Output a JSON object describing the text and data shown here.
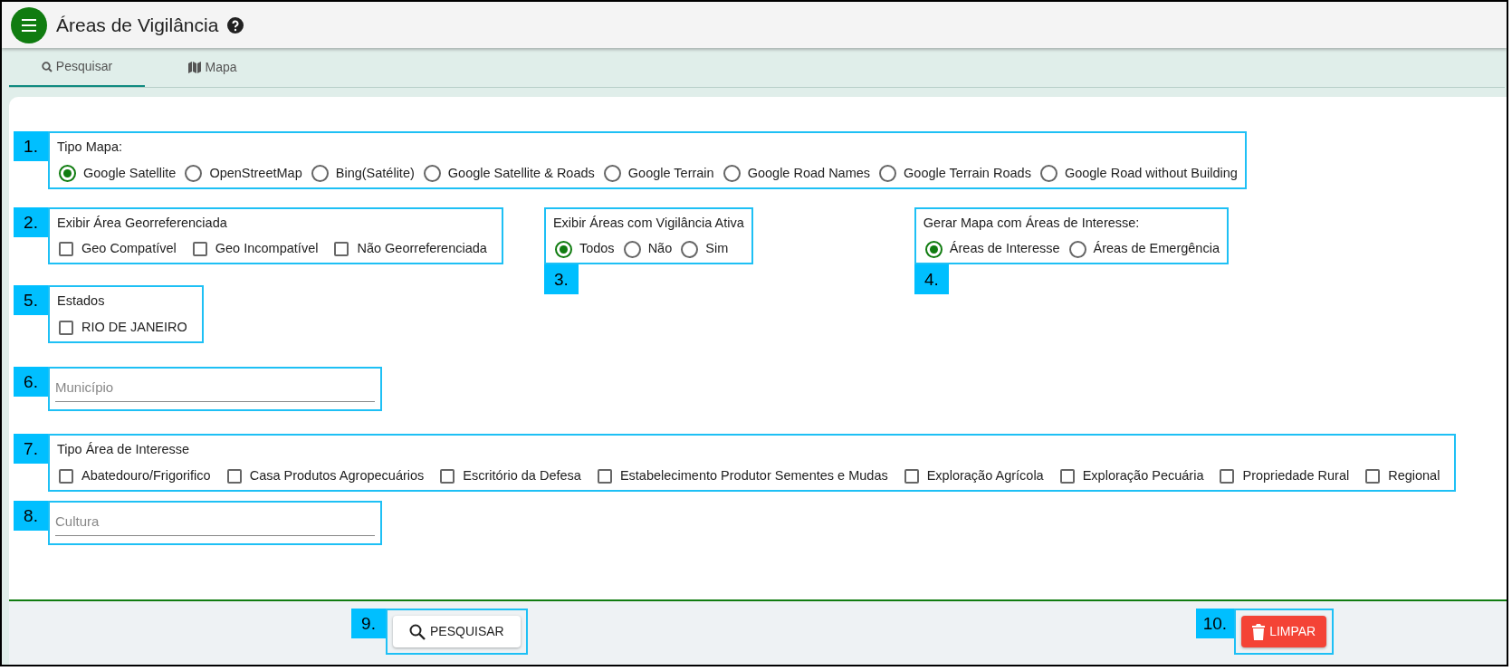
{
  "header": {
    "title": "Áreas de Vigilância"
  },
  "tabs": [
    {
      "label": "Pesquisar",
      "kind": "search",
      "selected": true
    },
    {
      "label": "Mapa",
      "kind": "map",
      "selected": false
    }
  ],
  "form": {
    "rows": [
      [
        {
          "callout": "1.",
          "callout_below": false,
          "kind": "radio",
          "label": "Tipo Mapa:",
          "options": [
            {
              "label": "Google Satellite",
              "selected": true
            },
            {
              "label": "OpenStreetMap",
              "selected": false
            },
            {
              "label": "Bing(Satélite)",
              "selected": false
            },
            {
              "label": "Google Satellite & Roads",
              "selected": false
            },
            {
              "label": "Google Terrain",
              "selected": false
            },
            {
              "label": "Google Road Names",
              "selected": false
            },
            {
              "label": "Google Terrain Roads",
              "selected": false
            },
            {
              "label": "Google Road without Building",
              "selected": false
            }
          ]
        }
      ],
      [
        {
          "callout": "2.",
          "callout_below": false,
          "kind": "checkbox",
          "label": "Exibir Área Georreferenciada",
          "options": [
            {
              "label": "Geo Compatível",
              "checked": false
            },
            {
              "label": "Geo Incompatível",
              "checked": false
            },
            {
              "label": "Não Georreferenciada",
              "checked": false
            }
          ]
        },
        {
          "callout": "3.",
          "callout_below": true,
          "kind": "radio",
          "label": "Exibir Áreas com Vigilância Ativa",
          "options": [
            {
              "label": "Todos",
              "selected": true
            },
            {
              "label": "Não",
              "selected": false
            },
            {
              "label": "Sim",
              "selected": false
            }
          ]
        },
        {
          "callout": "4.",
          "callout_below": true,
          "kind": "radio",
          "label": "Gerar Mapa com Áreas de Interesse:",
          "options": [
            {
              "label": "Áreas de Interesse",
              "selected": true
            },
            {
              "label": "Áreas de Emergência",
              "selected": false
            }
          ]
        }
      ],
      [
        {
          "callout": "5.",
          "callout_below": false,
          "kind": "checkbox",
          "label": "Estados",
          "options": [
            {
              "label": "RIO DE JANEIRO",
              "checked": false
            }
          ]
        }
      ],
      [
        {
          "callout": "6.",
          "callout_below": false,
          "kind": "text",
          "placeholder": "Município"
        }
      ],
      [
        {
          "callout": "7.",
          "callout_below": false,
          "kind": "checkbox",
          "label": "Tipo Área de Interesse",
          "options": [
            {
              "label": "Abatedouro/Frigorifico",
              "checked": false
            },
            {
              "label": "Casa Produtos Agropecuários",
              "checked": false
            },
            {
              "label": "Escritório da Defesa",
              "checked": false
            },
            {
              "label": "Estabelecimento Produtor Sementes e Mudas",
              "checked": false
            },
            {
              "label": "Exploração Agrícola",
              "checked": false
            },
            {
              "label": "Exploração Pecuária",
              "checked": false
            },
            {
              "label": "Propriedade Rural",
              "checked": false
            },
            {
              "label": "Regional",
              "checked": false
            }
          ]
        }
      ],
      [
        {
          "callout": "8.",
          "callout_below": false,
          "kind": "text",
          "placeholder": "Cultura"
        }
      ]
    ]
  },
  "footer": {
    "buttons": [
      {
        "callout": "9.",
        "label": "PESQUISAR",
        "kind": "search"
      },
      {
        "callout": "10.",
        "label": "LIMPAR",
        "kind": "clear"
      }
    ]
  }
}
